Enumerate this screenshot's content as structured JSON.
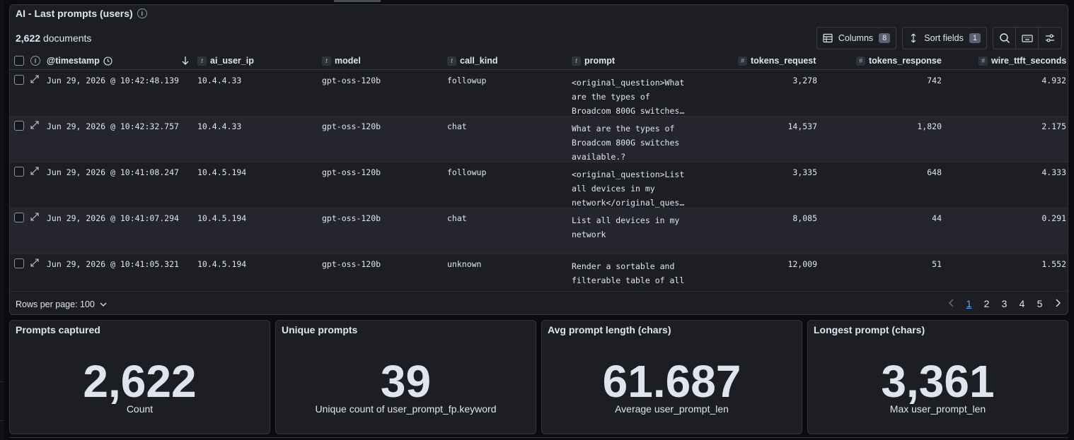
{
  "panel": {
    "title": "AI - Last prompts (users)",
    "doc_count": "2,622",
    "doc_count_label": "documents"
  },
  "toolbar": {
    "columns_label": "Columns",
    "columns_count": "8",
    "sort_label": "Sort fields",
    "sort_count": "1"
  },
  "columns": [
    {
      "label": "@timestamp",
      "type": ""
    },
    {
      "label": "ai_user_ip",
      "type": "t"
    },
    {
      "label": "model",
      "type": "t"
    },
    {
      "label": "call_kind",
      "type": "t"
    },
    {
      "label": "prompt",
      "type": "t"
    },
    {
      "label": "tokens_request",
      "type": "#"
    },
    {
      "label": "tokens_response",
      "type": "#"
    },
    {
      "label": "wire_ttft_seconds",
      "type": "#"
    }
  ],
  "rows": [
    {
      "timestamp": "Jun 29, 2026 @ 10:42:48.139",
      "ip": "10.4.4.33",
      "model": "gpt-oss-120b",
      "call_kind": "followup",
      "prompt": "<original_question>What are the types of Broadcom 800G switches…",
      "tokens_request": "3,278",
      "tokens_response": "742",
      "ttft": "4.932"
    },
    {
      "timestamp": "Jun 29, 2026 @ 10:42:32.757",
      "ip": "10.4.4.33",
      "model": "gpt-oss-120b",
      "call_kind": "chat",
      "prompt": "What are the types of Broadcom 800G switches available.?",
      "tokens_request": "14,537",
      "tokens_response": "1,820",
      "ttft": "2.175"
    },
    {
      "timestamp": "Jun 29, 2026 @ 10:41:08.247",
      "ip": "10.4.5.194",
      "model": "gpt-oss-120b",
      "call_kind": "followup",
      "prompt": "<original_question>List all devices in my network</original_ques…",
      "tokens_request": "3,335",
      "tokens_response": "648",
      "ttft": "4.333"
    },
    {
      "timestamp": "Jun 29, 2026 @ 10:41:07.294",
      "ip": "10.4.5.194",
      "model": "gpt-oss-120b",
      "call_kind": "chat",
      "prompt": "List all devices in my network",
      "tokens_request": "8,085",
      "tokens_response": "44",
      "ttft": "0.291"
    },
    {
      "timestamp": "Jun 29, 2026 @ 10:41:05.321",
      "ip": "10.4.5.194",
      "model": "gpt-oss-120b",
      "call_kind": "unknown",
      "prompt": "Render a sortable and filterable table of all",
      "tokens_request": "12,009",
      "tokens_response": "51",
      "ttft": "1.552"
    }
  ],
  "footer": {
    "rows_per_page": "Rows per page: 100",
    "pages": [
      "1",
      "2",
      "3",
      "4",
      "5"
    ],
    "active_page": "1"
  },
  "metrics": [
    {
      "title": "Prompts captured",
      "value": "2,622",
      "sub": "Count"
    },
    {
      "title": "Unique prompts",
      "value": "39",
      "sub": "Unique count of user_prompt_fp.keyword"
    },
    {
      "title": "Avg prompt length (chars)",
      "value": "61.687",
      "sub": "Average user_prompt_len"
    },
    {
      "title": "Longest prompt (chars)",
      "value": "3,361",
      "sub": "Max user_prompt_len"
    }
  ]
}
